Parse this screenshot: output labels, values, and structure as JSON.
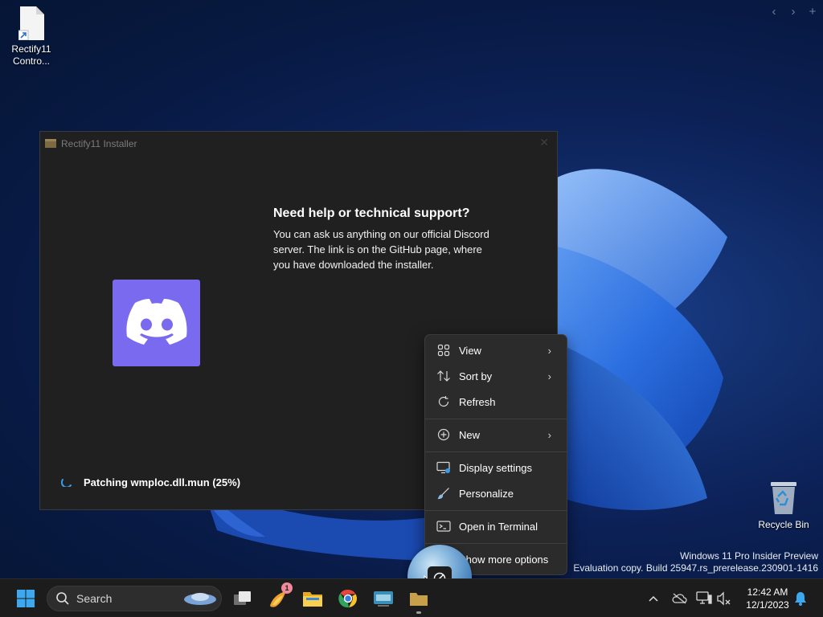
{
  "desktop": {
    "icons": [
      {
        "label_line1": "Rectify11",
        "label_line2": "Contro..."
      },
      {
        "label_line1": "Recycle Bin",
        "label_line2": ""
      }
    ],
    "watermark": {
      "line1": "Windows 11 Pro Insider Preview",
      "line2": "Evaluation copy. Build 25947.rs_prerelease.230901-1416"
    },
    "topnav": {
      "prev": "‹",
      "next": "›",
      "add": "+"
    }
  },
  "installer": {
    "title": "Rectify11 Installer",
    "close_glyph": "✕",
    "heading": "Need help or technical support?",
    "body": "You can ask us anything on our official Discord server. The link is on the GitHub page, where you have downloaded the installer.",
    "status": "Patching wmploc.dll.mun (25%)",
    "progress_percent": 25
  },
  "context_menu": {
    "items": [
      {
        "label": "View",
        "icon": "view-grid-icon",
        "submenu": true
      },
      {
        "label": "Sort by",
        "icon": "sort-arrows-icon",
        "submenu": true
      },
      {
        "label": "Refresh",
        "icon": "refresh-icon",
        "submenu": false
      },
      {
        "label": "New",
        "icon": "plus-circle-icon",
        "submenu": true
      },
      {
        "label": "Display settings",
        "icon": "display-icon",
        "submenu": false
      },
      {
        "label": "Personalize",
        "icon": "brush-icon",
        "submenu": false
      },
      {
        "label": "Open in Terminal",
        "icon": "terminal-icon",
        "submenu": false
      },
      {
        "label": "Show more options",
        "icon": "more-options-icon",
        "submenu": false
      }
    ],
    "submenu_glyph": "›"
  },
  "taskbar": {
    "search_label": "Search",
    "notification_count": "1",
    "clock": {
      "time": "12:42 AM",
      "date": "12/1/2023"
    },
    "apps": [
      "start-icon",
      "search-icon",
      "task-view-icon",
      "fireship-app-icon",
      "file-explorer-icon",
      "chrome-icon",
      "keyboard-app-icon",
      "folder-app-icon"
    ]
  },
  "colors": {
    "accent": "#0067c0",
    "discord": "#7a6af0",
    "menu_bg": "#2b2b2b",
    "taskbar_bg": "#1c1c1c"
  }
}
